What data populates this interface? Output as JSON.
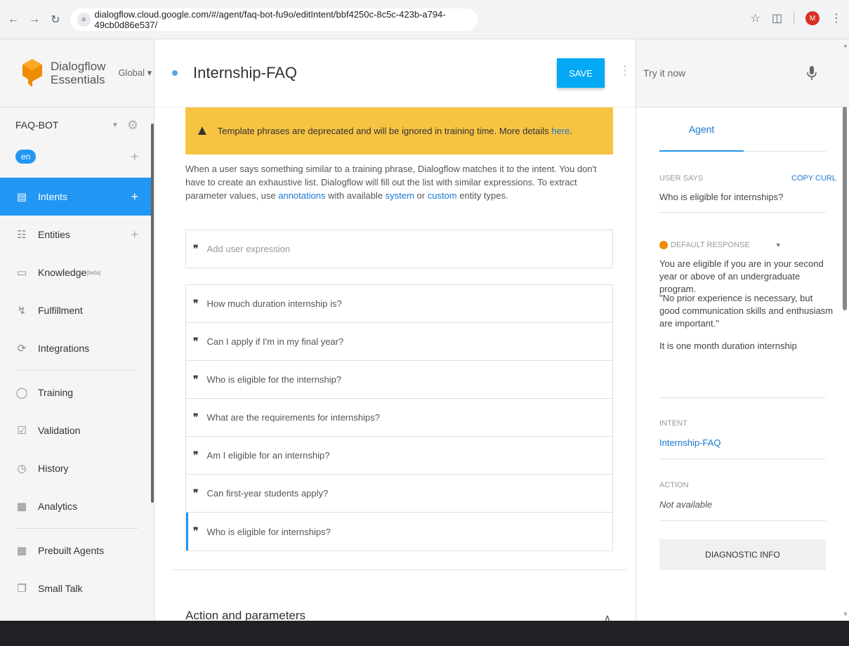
{
  "browser": {
    "url": "dialogflow.cloud.google.com/#/agent/faq-bot-fu9o/editIntent/bbf4250c-8c5c-423b-a794-49cb0d86e537/",
    "avatar_letter": "M"
  },
  "app": {
    "name_line1": "Dialogflow",
    "name_line2": "Essentials",
    "region": "Global ▾"
  },
  "agent": {
    "name": "FAQ-BOT",
    "language": "en"
  },
  "sidebar": {
    "items": [
      {
        "label": "Intents",
        "icon": "chat-icon"
      },
      {
        "label": "Entities",
        "icon": "hierarchy-icon"
      },
      {
        "label": "Knowledge",
        "beta": "[beta]",
        "icon": "book-icon"
      },
      {
        "label": "Fulfillment",
        "icon": "bolt-icon"
      },
      {
        "label": "Integrations",
        "icon": "sync-icon"
      },
      {
        "label": "Training",
        "icon": "graduation-cap-icon"
      },
      {
        "label": "Validation",
        "icon": "checkbox-icon"
      },
      {
        "label": "History",
        "icon": "clock-icon"
      },
      {
        "label": "Analytics",
        "icon": "chart-icon"
      },
      {
        "label": "Prebuilt Agents",
        "icon": "bookmark-icon"
      },
      {
        "label": "Small Talk",
        "icon": "copy-icon"
      }
    ]
  },
  "header": {
    "intent_name": "Internship-FAQ",
    "save_label": "SAVE"
  },
  "warning": {
    "text": "Template phrases are deprecated and will be ignored in training time. More details ",
    "link": "here",
    "end": "."
  },
  "info": {
    "part1": "When a user says something similar to a training phrase, Dialogflow matches it to the intent. You don't have to create an exhaustive list. Dialogflow will fill out the list with similar expressions. To extract parameter values, use ",
    "annotations": "annotations",
    "part2": " with available ",
    "system": "system",
    "part3": " or ",
    "custom": "custom",
    "part4": " entity types."
  },
  "training": {
    "placeholder": "Add user expression",
    "phrases": [
      "How much duration internship is?",
      "Can I apply if I'm in my final year?",
      "Who is eligible for the internship?",
      "What are the requirements for internships?",
      "Am I eligible for an internship?",
      "Can first-year students apply?",
      "Who is eligible for internships?"
    ]
  },
  "section": {
    "action_params": "Action and parameters"
  },
  "right_panel": {
    "try_it": "Try it now",
    "tab_agent": "Agent",
    "user_says_label": "USER SAYS",
    "copy_curl": "COPY CURL",
    "user_says": "Who is eligible for internships?",
    "default_response_label": "DEFAULT RESPONSE",
    "responses": [
      "You are eligible if you are in your second year or above of an undergraduate program.",
      "\"No prior experience is necessary, but good communication skills and enthusiasm are important.\"",
      "It is one month duration internship"
    ],
    "intent_label": "INTENT",
    "intent_value": "Internship-FAQ",
    "action_label": "ACTION",
    "action_value": "Not available",
    "diagnostic": "DIAGNOSTIC INFO"
  },
  "colors": {
    "primary": "#2196f3",
    "warning": "#f6c343",
    "logo": "#ef8b00"
  }
}
